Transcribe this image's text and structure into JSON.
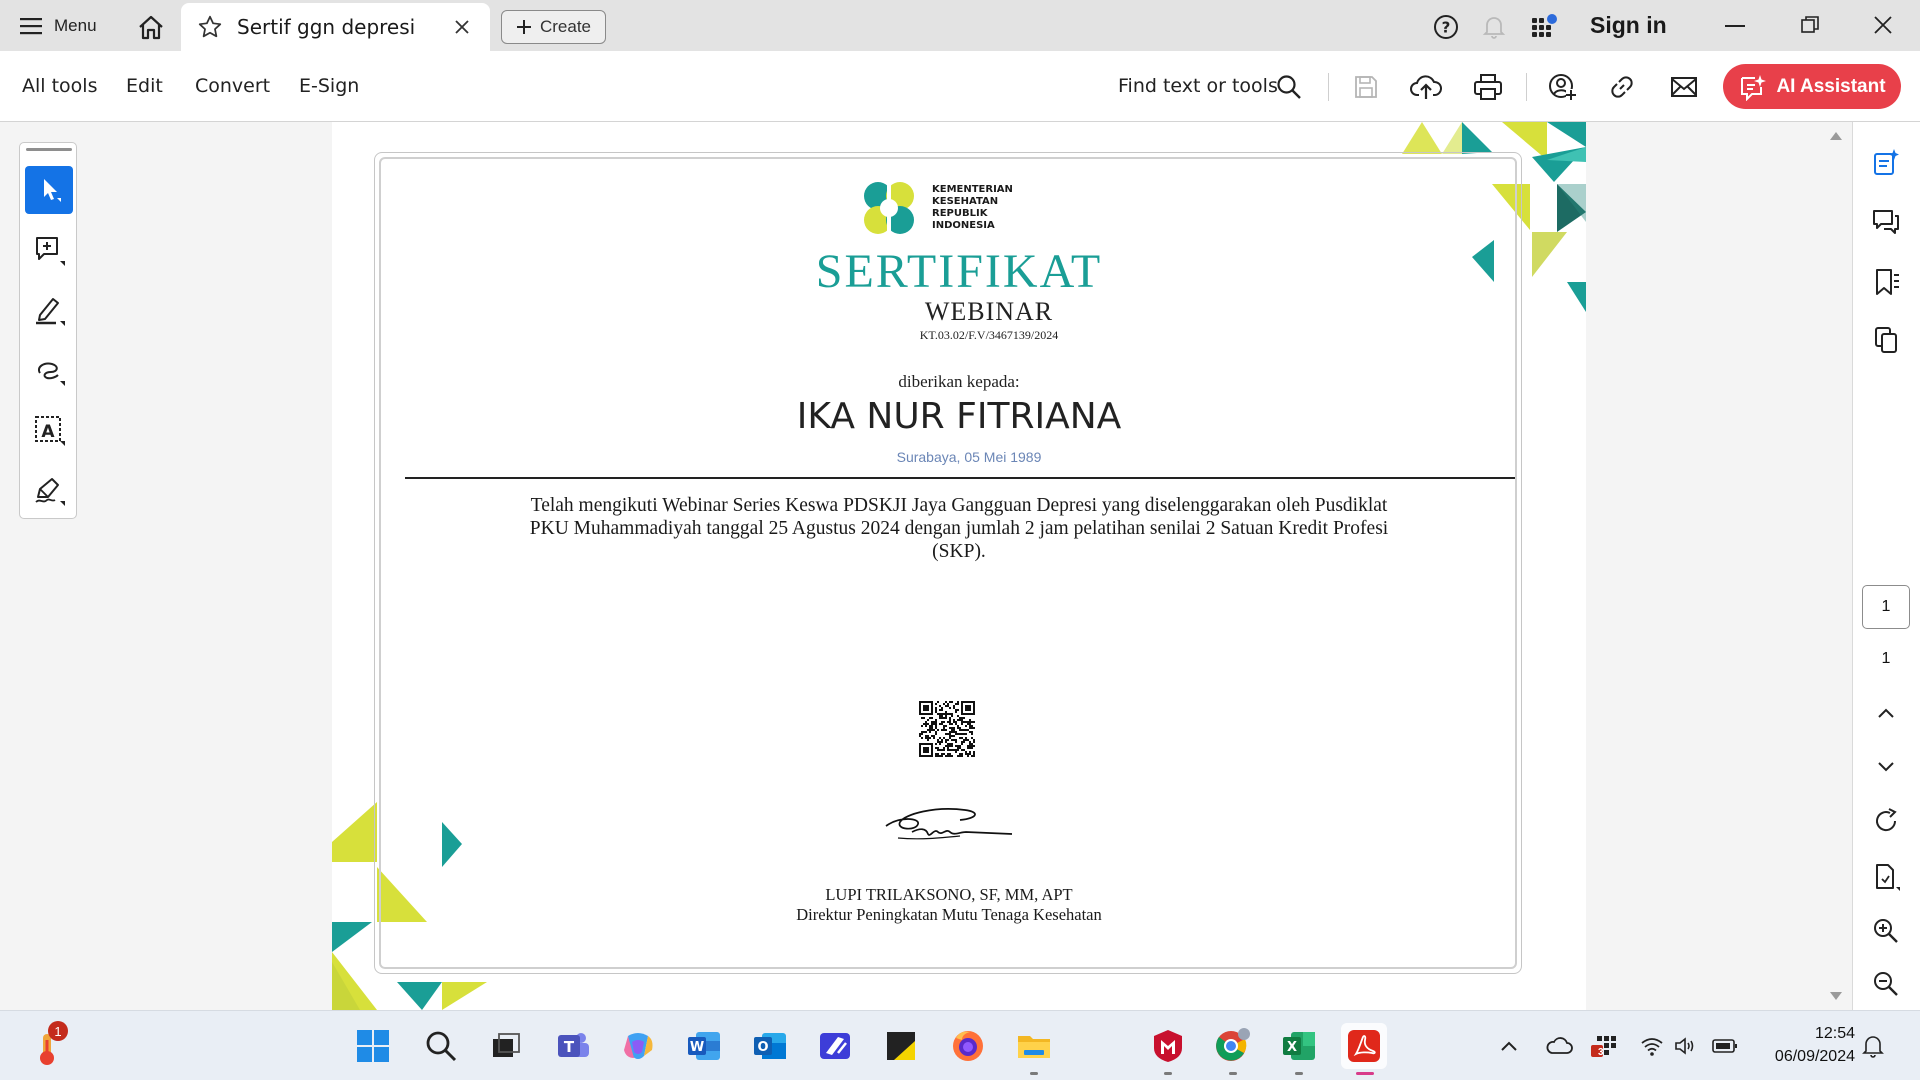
{
  "titlebar": {
    "menu_label": "Menu",
    "tab_title": "Sertif ggn depresi",
    "create_label": "Create",
    "signin_label": "Sign in"
  },
  "toolbar": {
    "menu": [
      "All tools",
      "Edit",
      "Convert",
      "E-Sign"
    ],
    "find_label": "Find text or tools",
    "ai_label": "AI Assistant",
    "accent": "#e8404a"
  },
  "certificate": {
    "ministry_lines": [
      "KEMENTERIAN",
      "KESEHATAN",
      "REPUBLIK",
      "INDONESIA"
    ],
    "title": "SERTIFIKAT",
    "subtitle": "WEBINAR",
    "number": "KT.03.02/F.V/3467139/2024",
    "given_to": "diberikan kepada:",
    "recipient": "IKA NUR FITRIANA",
    "birth": "Surabaya, 05 Mei 1989",
    "body_lines": [
      "Telah mengikuti Webinar Series Keswa PDSKJI Jaya  Gangguan Depresi yang diselenggarakan oleh Pusdiklat",
      "PKU Muhammadiyah tanggal 25 Agustus 2024 dengan jumlah 2 jam pelatihan senilai 2 Satuan Kredit Profesi",
      "(SKP)."
    ],
    "signer_name": "LUPI TRILAKSONO, SF, MM, APT",
    "signer_title": "Direktur Peningkatan Mutu Tenaga Kesehatan",
    "colors": {
      "teal": "#1a9e96",
      "lime": "#d7e03b",
      "dark_teal": "#1d6b63"
    }
  },
  "page_nav": {
    "current_page": "1",
    "total_pages": "1"
  },
  "taskbar": {
    "weather_badge": "1",
    "mail_badge": "3",
    "time": "12:54",
    "date": "06/09/2024"
  }
}
